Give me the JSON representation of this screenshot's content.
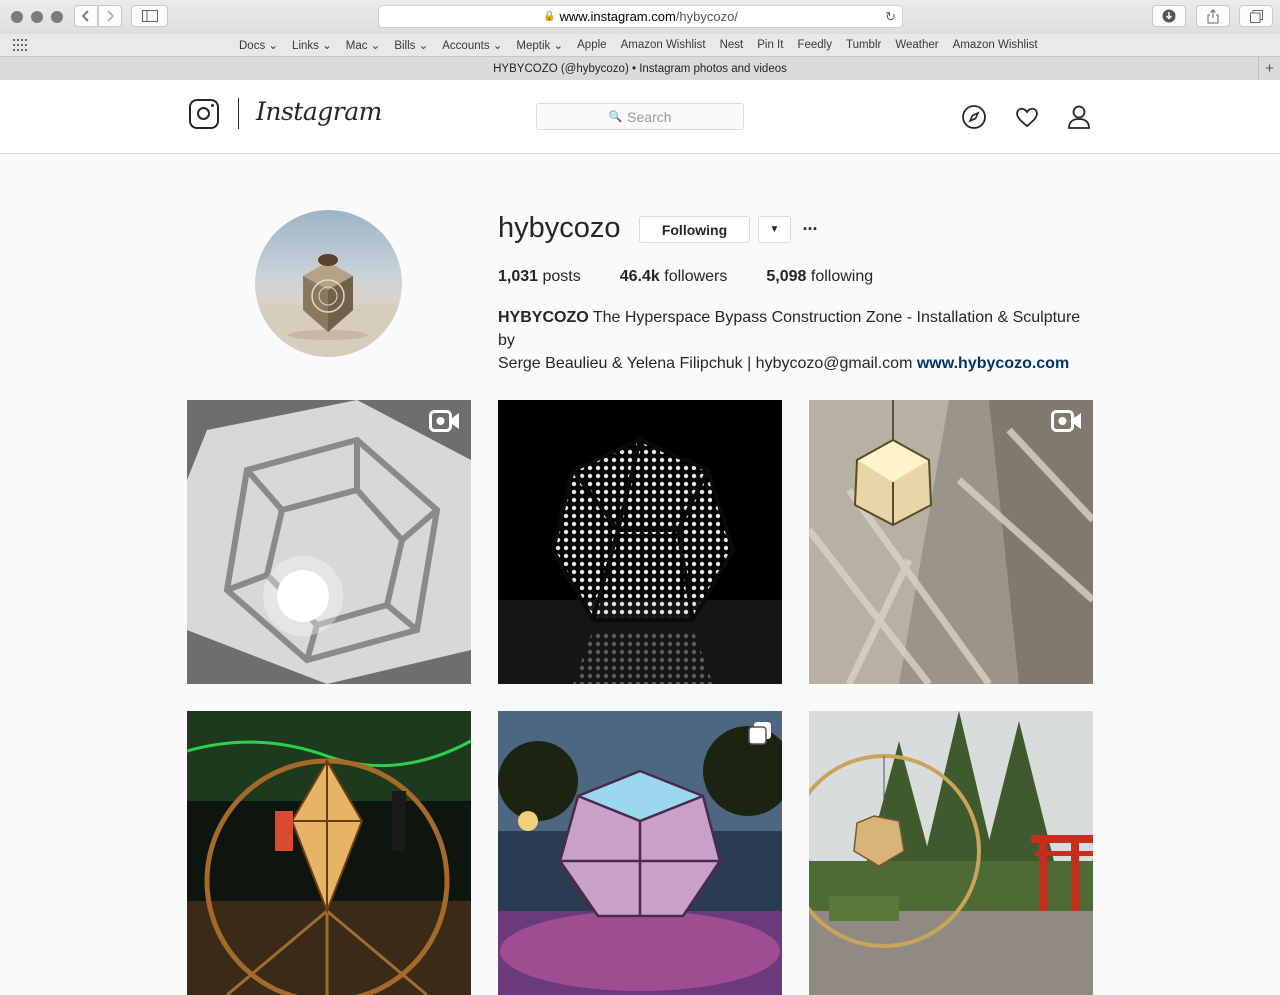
{
  "browser": {
    "url_host": "www.instagram.com",
    "url_path": "/hybycozo/",
    "tab_title": "HYBYCOZO (@hybycozo) • Instagram photos and videos",
    "bookmarks": [
      "Docs",
      "Links",
      "Mac",
      "Bills",
      "Accounts",
      "Meptik",
      "Apple",
      "Amazon Wishlist",
      "Nest",
      "Pin It",
      "Feedly",
      "Tumblr",
      "Weather",
      "Amazon Wishlist"
    ],
    "bookmark_dropdown": [
      true,
      true,
      true,
      true,
      true,
      true,
      false,
      false,
      false,
      false,
      false,
      false,
      false,
      false
    ]
  },
  "header": {
    "logo_text": "Instagram",
    "search_placeholder": "Search",
    "icons": [
      "explore-icon",
      "heart-icon",
      "profile-icon"
    ]
  },
  "profile": {
    "username": "hybycozo",
    "follow_label": "Following",
    "posts_count": "1,031",
    "posts_label": "posts",
    "followers_count": "46.4k",
    "followers_label": "followers",
    "following_count": "5,098",
    "following_label": "following",
    "bio_name": "HYBYCOZO",
    "bio_line1": "The Hyperspace Bypass Construction Zone - Installation & Sculpture by",
    "bio_line2": "Serge Beaulieu & Yelena Filipchuk | hybycozo@gmail.com",
    "bio_link": "www.hybycozo.com"
  },
  "posts": [
    {
      "type": "video",
      "scene": "white-lattice-polyhedron"
    },
    {
      "type": "image",
      "scene": "dark-perforated-dodecahedron"
    },
    {
      "type": "video",
      "scene": "hanging-lamp-shadows"
    },
    {
      "type": "image",
      "scene": "garden-night-diamond-lamp"
    },
    {
      "type": "carousel",
      "scene": "pink-glowing-dodecahedron"
    },
    {
      "type": "image",
      "scene": "ring-sculpture-garden"
    }
  ],
  "colors": {
    "link": "#003569",
    "border": "#dbdbdb",
    "text": "#262626",
    "background": "#fafafa"
  }
}
